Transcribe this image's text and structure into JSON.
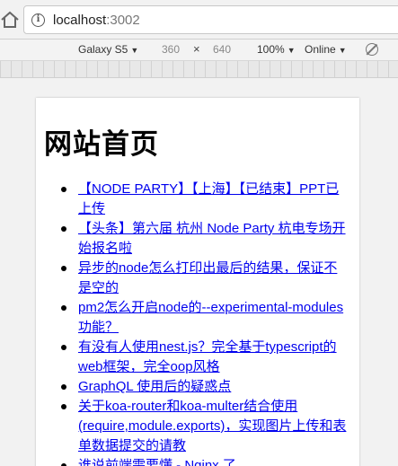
{
  "browser": {
    "url_host": "localhost",
    "url_port": ":3002"
  },
  "device_toolbar": {
    "device": "Galaxy S5",
    "width": "360",
    "times": "×",
    "height": "640",
    "zoom": "100%",
    "network": "Online"
  },
  "page": {
    "title": "网站首页",
    "links": [
      "【NODE PARTY】【上海】【已结束】PPT已上传",
      "【头条】第六届 杭州 Node Party 杭电专场开始报名啦",
      "异步的node怎么打印出最后的结果，保证不是空的",
      "pm2怎么开启node的--experimental-modules功能？",
      "有没有人使用nest.js？完全基于typescript的web框架，完全oop风格",
      "GraphQL 使用后的疑惑点",
      "关于koa-router和koa-multer结合使用(require,module.exports)，实现图片上传和表单数据提交的请教",
      "谁说前端需要懂 - Nginx 了"
    ]
  }
}
